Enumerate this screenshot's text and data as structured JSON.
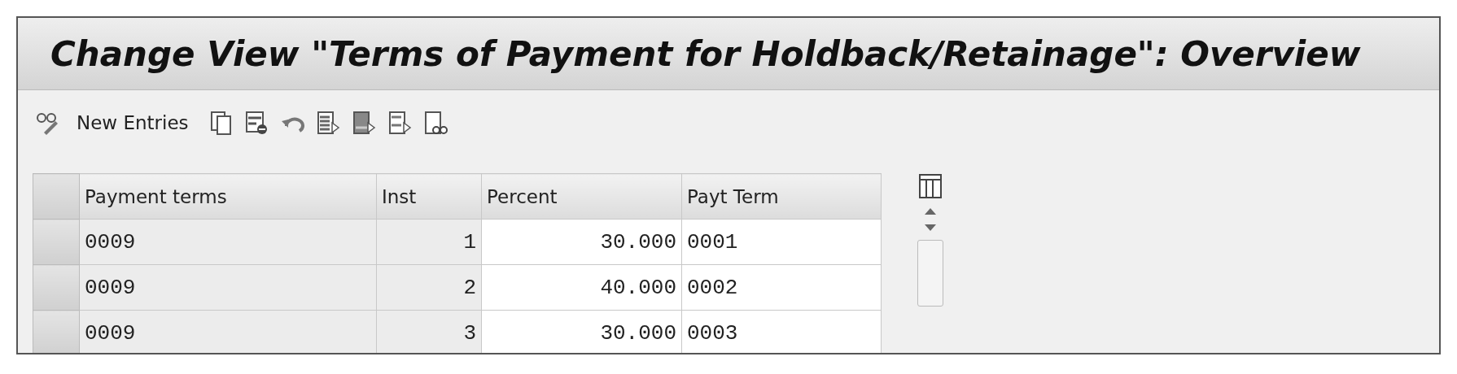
{
  "title": "Change View \"Terms of Payment for Holdback/Retainage\": Overview",
  "toolbar": {
    "new_entries": "New Entries"
  },
  "table": {
    "columns": [
      {
        "label": "Payment terms",
        "editable": false,
        "kind": "text"
      },
      {
        "label": "Inst",
        "editable": false,
        "kind": "number"
      },
      {
        "label": "Percent",
        "editable": true,
        "kind": "number"
      },
      {
        "label": "Payt Term",
        "editable": true,
        "kind": "text"
      }
    ],
    "rows": [
      [
        "0009",
        "1",
        "30.000",
        "0001"
      ],
      [
        "0009",
        "2",
        "40.000",
        "0002"
      ],
      [
        "0009",
        "3",
        "30.000",
        "0003"
      ]
    ]
  }
}
